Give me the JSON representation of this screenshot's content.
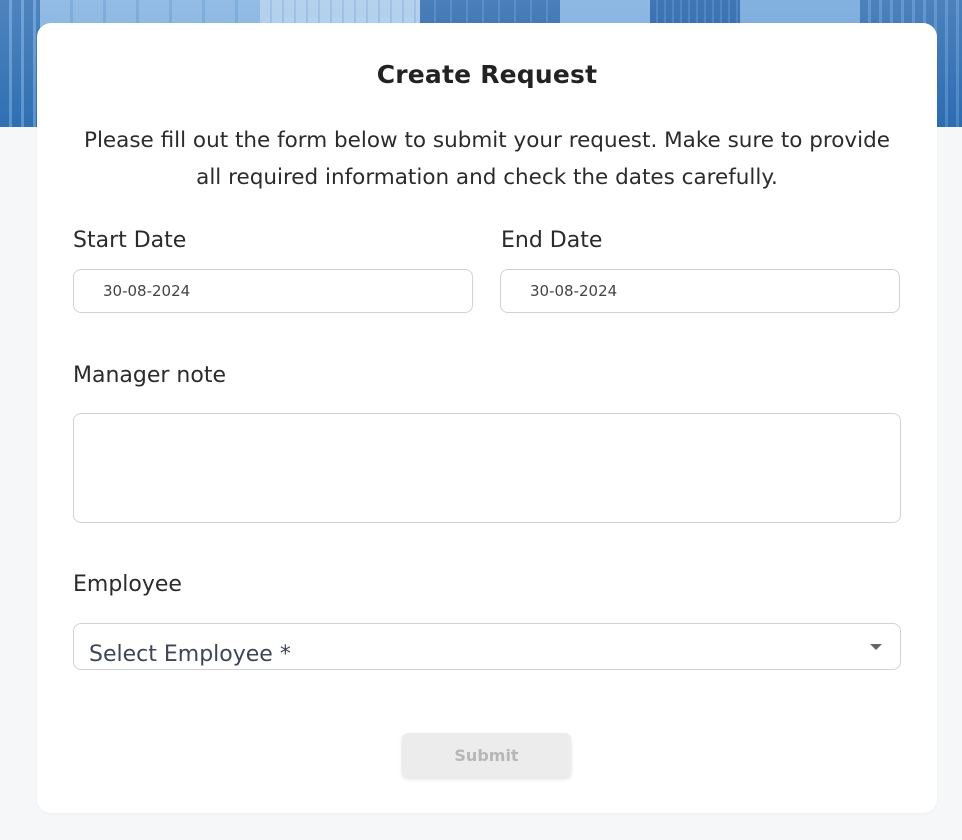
{
  "form": {
    "title": "Create Request",
    "description": "Please fill out the form below to submit your request. Make sure to provide all required information and check the dates carefully.",
    "start_date": {
      "label": "Start Date",
      "value": "30-08-2024"
    },
    "end_date": {
      "label": "End Date",
      "value": "30-08-2024"
    },
    "manager_note": {
      "label": "Manager note",
      "value": ""
    },
    "employee": {
      "label": "Employee",
      "placeholder": "Select Employee *",
      "icon": "chevron-down-icon"
    },
    "submit_label": "Submit"
  },
  "colors": {
    "card_background": "#ffffff",
    "page_background": "#f6f7f9",
    "banner_blue": "#4a86c6",
    "border": "#cfd3d9",
    "text": "#222222",
    "submit_disabled_bg": "#ececec",
    "submit_disabled_text": "#b7b7b7"
  }
}
